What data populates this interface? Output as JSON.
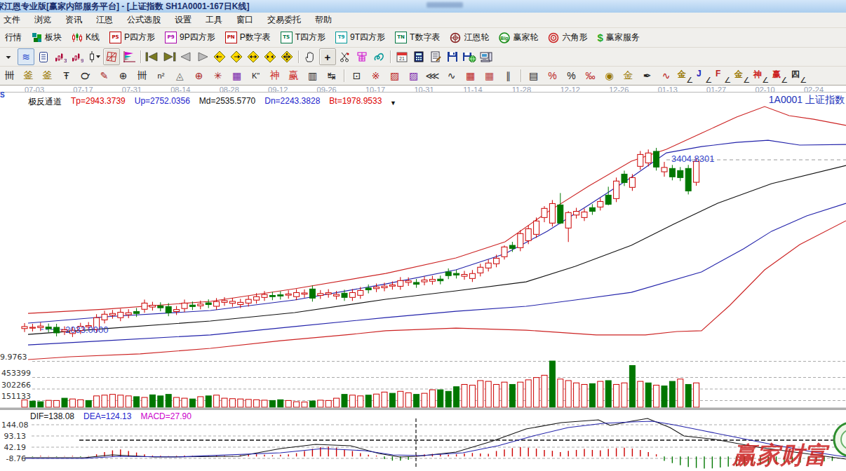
{
  "window": {
    "title": "家江恩专业版[赢家内部服务平台] - [上证指数  SH1A0001-167日K线]"
  },
  "menu": {
    "items": [
      "文件",
      "浏览",
      "资讯",
      "江恩",
      "公式选股",
      "设置",
      "工具",
      "窗口",
      "交易委托",
      "帮助"
    ]
  },
  "toolbar1": {
    "buttons": [
      {
        "name": "quote-button",
        "icon": "none",
        "label": "行情"
      },
      {
        "name": "sectors-button",
        "icon": "blocks",
        "label": "板块"
      },
      {
        "name": "kline-button",
        "icon": "candles",
        "label": "K线"
      },
      {
        "name": "p-square-button",
        "icon": "box",
        "btxt": "PS",
        "bcol": "#bb0000",
        "label": "P四方形"
      },
      {
        "name": "p9-square-button",
        "icon": "box",
        "btxt": "P9",
        "bcol": "#aa00aa",
        "label": "9P四方形"
      },
      {
        "name": "p-number-button",
        "icon": "box",
        "btxt": "PN",
        "bcol": "#bb0000",
        "label": "P数字表"
      },
      {
        "name": "t-square-button",
        "icon": "box",
        "btxt": "TS",
        "bcol": "#007744",
        "label": "T四方形"
      },
      {
        "name": "t9-square-button",
        "icon": "box",
        "btxt": "T9",
        "bcol": "#009999",
        "label": "9T四方形"
      },
      {
        "name": "t-number-button",
        "icon": "box",
        "btxt": "TN",
        "bcol": "#007744",
        "label": "T数字表"
      },
      {
        "name": "gann-wheel-button",
        "icon": "wheel",
        "label": "江恩轮"
      },
      {
        "name": "winner-wheel-button",
        "icon": "big",
        "label": "赢家轮"
      },
      {
        "name": "hexagon-button",
        "icon": "hexa",
        "label": "六角形"
      },
      {
        "name": "winner-service-button",
        "icon": "dollar",
        "label": "赢家服务"
      }
    ]
  },
  "dates": [
    "07-03",
    "07-17",
    "07-31",
    "08-14",
    "08-28",
    "09-12",
    "09-26",
    "10-17",
    "10-31",
    "11-14",
    "11-28",
    "12-12",
    "12-26",
    "01-13",
    "01-27",
    "02-10",
    "02-24"
  ],
  "legend": {
    "name": "极反通道",
    "tp": "Tp=2943.3739",
    "up": "Up=2752.0356",
    "md": "Md=2535.5770",
    "dn": "Dn=2243.3828",
    "bt": "Bt=1978.9533"
  },
  "symbol_label": "1A0001 上证指数",
  "annotations": {
    "high": "3404.8301",
    "low": "2033.0000"
  },
  "volume_axis": [
    "9.9763",
    "453399",
    "302266",
    "151133"
  ],
  "macd_panel": {
    "dif": "DIF=138.08",
    "dea": "DEA=124.13",
    "macd": "MACD=27.90",
    "axis": [
      "144.08",
      "93.13",
      "42.19",
      "-8.76"
    ]
  },
  "watermark": "赢家财富网",
  "chart_data": {
    "type": "candlestick",
    "symbol": "1A0001 上证指数",
    "period": "167日K线",
    "price_anchor": {
      "high_line": 3404.8301,
      "low_line": 2033.0
    },
    "channel": {
      "tp": [
        [
          40,
          2163
        ],
        [
          150,
          2197
        ],
        [
          300,
          2260
        ],
        [
          420,
          2362
        ],
        [
          550,
          2486
        ],
        [
          650,
          2611
        ],
        [
          720,
          2742
        ],
        [
          780,
          2980
        ],
        [
          840,
          3195
        ],
        [
          900,
          3393
        ],
        [
          950,
          3490
        ],
        [
          1000,
          3620
        ],
        [
          1050,
          3750
        ],
        [
          1090,
          3835
        ],
        [
          1125,
          3762
        ],
        [
          1160,
          3733
        ],
        [
          1206,
          3683
        ]
      ],
      "up": [
        [
          40,
          2084
        ],
        [
          150,
          2135
        ],
        [
          300,
          2186
        ],
        [
          420,
          2271
        ],
        [
          550,
          2401
        ],
        [
          650,
          2515
        ],
        [
          720,
          2645
        ],
        [
          780,
          2827
        ],
        [
          840,
          3042
        ],
        [
          900,
          3263
        ],
        [
          950,
          3461
        ],
        [
          1000,
          3512
        ],
        [
          1050,
          3546
        ],
        [
          1095,
          3563
        ],
        [
          1140,
          3524
        ],
        [
          1206,
          3529
        ]
      ],
      "md": [
        [
          40,
          1993
        ],
        [
          150,
          2039
        ],
        [
          300,
          2101
        ],
        [
          420,
          2169
        ],
        [
          550,
          2277
        ],
        [
          650,
          2345
        ],
        [
          750,
          2418
        ],
        [
          820,
          2543
        ],
        [
          900,
          2713
        ],
        [
          960,
          2883
        ],
        [
          1023,
          3053
        ],
        [
          1100,
          3212
        ],
        [
          1206,
          3359
        ]
      ],
      "dn": [
        [
          40,
          1908
        ],
        [
          150,
          1942
        ],
        [
          300,
          1988
        ],
        [
          420,
          2056
        ],
        [
          550,
          2129
        ],
        [
          650,
          2180
        ],
        [
          750,
          2220
        ],
        [
          820,
          2271
        ],
        [
          900,
          2333
        ],
        [
          1000,
          2498
        ],
        [
          1060,
          2685
        ],
        [
          1100,
          2827
        ],
        [
          1150,
          2951
        ],
        [
          1206,
          3053
        ]
      ],
      "bt": [
        [
          40,
          1789
        ],
        [
          100,
          1812
        ],
        [
          200,
          1835
        ],
        [
          300,
          1880
        ],
        [
          400,
          1942
        ],
        [
          500,
          1993
        ],
        [
          550,
          2022
        ],
        [
          650,
          2044
        ],
        [
          750,
          2027
        ],
        [
          850,
          1988
        ],
        [
          920,
          1988
        ],
        [
          965,
          2016
        ],
        [
          1000,
          2022
        ],
        [
          1040,
          2226
        ],
        [
          1090,
          2515
        ],
        [
          1140,
          2719
        ],
        [
          1206,
          2912
        ]
      ]
    },
    "candles": [
      [
        0,
        2040,
        2056
      ],
      [
        0,
        2045,
        2050
      ],
      [
        0,
        2048,
        2060
      ],
      [
        1,
        2038,
        2052
      ],
      [
        1,
        2005,
        2050
      ],
      [
        0,
        2016,
        2030
      ],
      [
        0,
        2000,
        2026
      ],
      [
        0,
        2024,
        2058
      ],
      [
        0,
        2054,
        2064
      ],
      [
        0,
        2033,
        2128
      ],
      [
        0,
        2110,
        2156
      ],
      [
        0,
        2148,
        2162
      ],
      [
        0,
        2128,
        2172
      ],
      [
        0,
        2152,
        2168
      ],
      [
        1,
        2162,
        2178
      ],
      [
        0,
        2196,
        2246
      ],
      [
        0,
        2214,
        2228
      ],
      [
        1,
        2208,
        2224
      ],
      [
        1,
        2168,
        2218
      ],
      [
        0,
        2178,
        2194
      ],
      [
        0,
        2202,
        2246
      ],
      [
        1,
        2218,
        2230
      ],
      [
        0,
        2224,
        2238
      ],
      [
        1,
        2234,
        2248
      ],
      [
        0,
        2220,
        2258
      ],
      [
        0,
        2252,
        2266
      ],
      [
        0,
        2244,
        2260
      ],
      [
        0,
        2234,
        2252
      ],
      [
        0,
        2246,
        2276
      ],
      [
        0,
        2270,
        2298
      ],
      [
        0,
        2292,
        2315
      ],
      [
        1,
        2298,
        2308
      ],
      [
        1,
        2303,
        2313
      ],
      [
        0,
        2310,
        2320
      ],
      [
        0,
        2298,
        2331
      ],
      [
        0,
        2318,
        2328
      ],
      [
        1,
        2286,
        2360
      ],
      [
        0,
        2308,
        2323
      ],
      [
        0,
        2318,
        2330
      ],
      [
        0,
        2303,
        2316
      ],
      [
        1,
        2292,
        2326
      ],
      [
        0,
        2292,
        2331
      ],
      [
        0,
        2309,
        2348
      ],
      [
        1,
        2353,
        2368
      ],
      [
        0,
        2363,
        2376
      ],
      [
        0,
        2370,
        2383
      ],
      [
        0,
        2383,
        2393
      ],
      [
        0,
        2382,
        2428
      ],
      [
        0,
        2413,
        2426
      ],
      [
        1,
        2398,
        2413
      ],
      [
        0,
        2418,
        2433
      ],
      [
        0,
        2423,
        2438
      ],
      [
        1,
        2426,
        2440
      ],
      [
        1,
        2468,
        2498
      ],
      [
        1,
        2473,
        2486
      ],
      [
        0,
        2463,
        2478
      ],
      [
        0,
        2445,
        2485
      ],
      [
        0,
        2490,
        2536
      ],
      [
        0,
        2530,
        2570
      ],
      [
        0,
        2564,
        2609
      ],
      [
        0,
        2621,
        2700,
        2598,
        2712
      ],
      [
        1,
        2688,
        2713
      ],
      [
        0,
        2694,
        2808
      ],
      [
        0,
        2751,
        2847
      ],
      [
        0,
        2802,
        2910
      ],
      [
        0,
        2938,
        3012,
        2900,
        3030
      ],
      [
        0,
        2893,
        3051
      ],
      [
        1,
        2893,
        3040,
        2885,
        3136
      ],
      [
        0,
        2853,
        2978,
        2740,
        2990
      ],
      [
        0,
        2958,
        2988
      ],
      [
        0,
        2938,
        2983
      ],
      [
        1,
        2988,
        3018
      ],
      [
        0,
        3023,
        3068
      ],
      [
        1,
        3045,
        3119,
        3037,
        3187
      ],
      [
        0,
        3091,
        3233
      ],
      [
        1,
        3221,
        3289
      ],
      [
        0,
        3182,
        3261
      ],
      [
        0,
        3352,
        3448
      ],
      [
        0,
        3380,
        3460
      ],
      [
        1,
        3346,
        3473
      ],
      [
        0,
        3308,
        3343,
        3268,
        3388
      ],
      [
        1,
        3267,
        3335
      ],
      [
        1,
        3261,
        3318
      ],
      [
        1,
        3153,
        3335
      ],
      [
        0,
        3223,
        3391
      ]
    ],
    "volumes": [
      [
        95,
        0
      ],
      [
        80,
        1
      ],
      [
        72,
        1
      ],
      [
        90,
        0
      ],
      [
        88,
        0
      ],
      [
        118,
        1
      ],
      [
        108,
        0
      ],
      [
        98,
        0
      ],
      [
        88,
        1
      ],
      [
        148,
        0
      ],
      [
        158,
        0
      ],
      [
        168,
        0
      ],
      [
        158,
        0
      ],
      [
        148,
        0
      ],
      [
        138,
        1
      ],
      [
        128,
        0
      ],
      [
        162,
        1
      ],
      [
        148,
        1
      ],
      [
        168,
        1
      ],
      [
        128,
        0
      ],
      [
        118,
        0
      ],
      [
        108,
        1
      ],
      [
        138,
        0
      ],
      [
        148,
        1
      ],
      [
        158,
        0
      ],
      [
        118,
        0
      ],
      [
        112,
        0
      ],
      [
        108,
        0
      ],
      [
        102,
        0
      ],
      [
        98,
        0
      ],
      [
        92,
        0
      ],
      [
        88,
        1
      ],
      [
        98,
        1
      ],
      [
        88,
        0
      ],
      [
        72,
        0
      ],
      [
        68,
        0
      ],
      [
        82,
        1
      ],
      [
        92,
        0
      ],
      [
        88,
        0
      ],
      [
        118,
        0
      ],
      [
        168,
        1
      ],
      [
        158,
        0
      ],
      [
        148,
        0
      ],
      [
        158,
        1
      ],
      [
        172,
        0
      ],
      [
        198,
        0
      ],
      [
        182,
        1
      ],
      [
        208,
        0
      ],
      [
        188,
        0
      ],
      [
        168,
        1
      ],
      [
        182,
        0
      ],
      [
        228,
        0
      ],
      [
        228,
        1
      ],
      [
        208,
        1
      ],
      [
        268,
        1
      ],
      [
        298,
        0
      ],
      [
        288,
        0
      ],
      [
        348,
        0
      ],
      [
        338,
        0
      ],
      [
        298,
        0
      ],
      [
        328,
        0
      ],
      [
        298,
        1
      ],
      [
        328,
        0
      ],
      [
        358,
        0
      ],
      [
        388,
        0
      ],
      [
        418,
        0
      ],
      [
        604,
        1
      ],
      [
        368,
        0
      ],
      [
        348,
        0
      ],
      [
        318,
        0
      ],
      [
        298,
        0
      ],
      [
        308,
        1
      ],
      [
        338,
        0
      ],
      [
        348,
        1
      ],
      [
        298,
        0
      ],
      [
        318,
        0
      ],
      [
        545,
        1
      ],
      [
        338,
        0
      ],
      [
        318,
        1
      ],
      [
        288,
        0
      ],
      [
        278,
        1
      ],
      [
        338,
        1
      ],
      [
        368,
        0
      ],
      [
        298,
        1
      ],
      [
        318,
        0
      ]
    ],
    "volume_unit": 1000,
    "macd_hist": [
      2,
      -2,
      3,
      2,
      -2,
      2,
      3,
      -2,
      2,
      10,
      20,
      28,
      32,
      25,
      18,
      10,
      4,
      3,
      2,
      3,
      4,
      3,
      2,
      3,
      4,
      3,
      2,
      6,
      8,
      10,
      8,
      6,
      8,
      10,
      15,
      25,
      35,
      42,
      45,
      40,
      32,
      25,
      15,
      8,
      4,
      -12,
      -19,
      -19,
      -15,
      6,
      10,
      12,
      10,
      8,
      10,
      14,
      16,
      14,
      12,
      25,
      32,
      38,
      42,
      40,
      36,
      30,
      26,
      20,
      26,
      30,
      34,
      30,
      28,
      34,
      38,
      40,
      36,
      30,
      20,
      10,
      -20,
      -30,
      -40,
      -48,
      -52,
      -55,
      -54,
      -50,
      -46,
      -44,
      -42,
      -40,
      -38,
      -36,
      -34,
      -32,
      -30,
      -28,
      -26,
      -24,
      -22,
      -20
    ],
    "dif_curve": [
      [
        35,
        -5.4
      ],
      [
        120,
        -5.4
      ],
      [
        160,
        7.3
      ],
      [
        220,
        -2.2
      ],
      [
        340,
        1
      ],
      [
        400,
        36
      ],
      [
        450,
        55.1
      ],
      [
        500,
        48.7
      ],
      [
        540,
        13.7
      ],
      [
        570,
        -2.2
      ],
      [
        595,
        1
      ],
      [
        650,
        20.1
      ],
      [
        700,
        67.8
      ],
      [
        750,
        125.2
      ],
      [
        800,
        153.8
      ],
      [
        853,
        166.6
      ],
      [
        870,
        141.1
      ],
      [
        900,
        160.2
      ],
      [
        923,
        172.9
      ],
      [
        955,
        131.5
      ],
      [
        975,
        93.3
      ],
      [
        1020,
        77.4
      ],
      [
        1080,
        42.4
      ],
      [
        1140,
        16.9
      ],
      [
        1206,
        -11.8
      ]
    ],
    "dea_curve": [
      [
        35,
        -8.6
      ],
      [
        120,
        -8.6
      ],
      [
        170,
        1
      ],
      [
        250,
        -2.2
      ],
      [
        400,
        16.9
      ],
      [
        460,
        36
      ],
      [
        520,
        26.4
      ],
      [
        560,
        7.3
      ],
      [
        600,
        4.1
      ],
      [
        660,
        16.9
      ],
      [
        710,
        48.7
      ],
      [
        760,
        93.3
      ],
      [
        810,
        131.5
      ],
      [
        860,
        150.6
      ],
      [
        900,
        157
      ],
      [
        930,
        160.2
      ],
      [
        960,
        144.3
      ],
      [
        1000,
        118.8
      ],
      [
        1050,
        86.9
      ],
      [
        1100,
        55.1
      ],
      [
        1160,
        20.1
      ],
      [
        1206,
        -2.2
      ]
    ]
  }
}
